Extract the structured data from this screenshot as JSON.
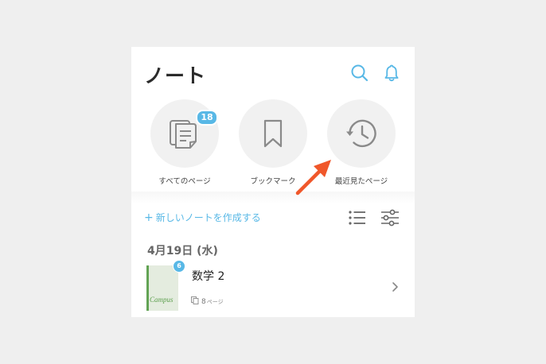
{
  "header": {
    "title": "ノート",
    "search_icon": "search-icon",
    "bell_icon": "bell-icon"
  },
  "quick_access": [
    {
      "label": "すべてのページ",
      "icon": "pages-icon",
      "badge": "18"
    },
    {
      "label": "ブックマーク",
      "icon": "bookmark-icon"
    },
    {
      "label": "最近見たページ",
      "icon": "history-icon"
    }
  ],
  "actions": {
    "new_note_plus": "+",
    "new_note_label": "新しいノートを作成する",
    "list_view_icon": "list-icon",
    "filter_icon": "sliders-icon"
  },
  "date_group": {
    "date": "4月19日 (水)"
  },
  "notes": [
    {
      "title": "数学 2",
      "badge": "6",
      "cover_brand": "Campus",
      "page_count": "8",
      "page_unit": "ページ"
    }
  ],
  "colors": {
    "accent": "#58b8e6",
    "arrow": "#f0572a",
    "background": "#efefef",
    "notebook_green": "#62a354"
  }
}
